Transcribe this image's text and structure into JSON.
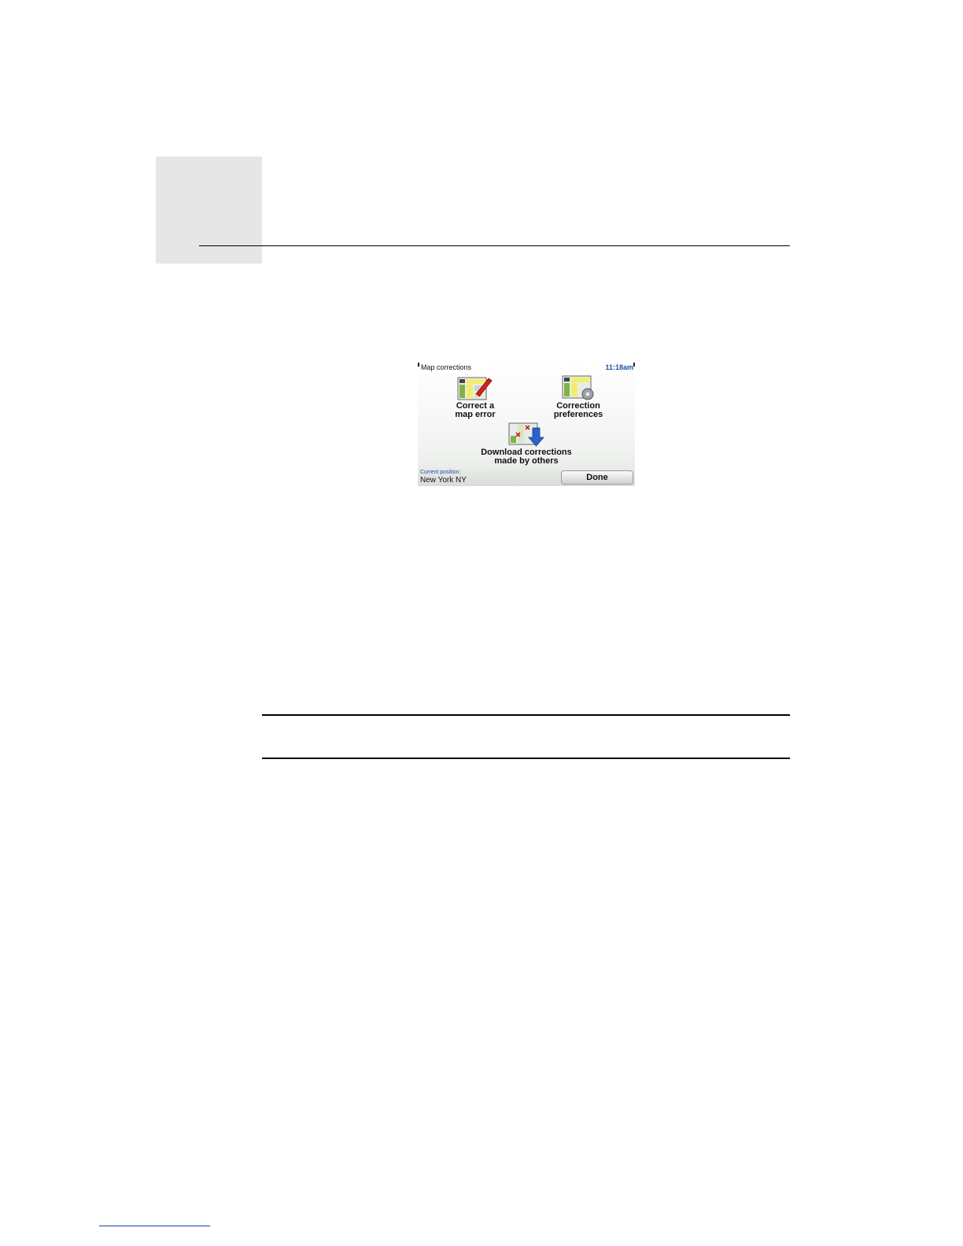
{
  "screenshot": {
    "title": "Map corrections",
    "clock": "11:18am",
    "buttons": [
      {
        "line1": "Correct a",
        "line2": "map error",
        "icon": "map-pencil-icon"
      },
      {
        "line1": "Correction",
        "line2": "preferences",
        "icon": "map-gear-icon"
      },
      {
        "line1": "Download corrections",
        "line2": "made by others",
        "icon": "map-download-icon"
      }
    ],
    "position_label": "Current position:",
    "position_value": "New York NY",
    "done_label": "Done"
  },
  "colors": {
    "accent_blue": "#1a4fa8",
    "chapter_box": "#e6e6e6"
  }
}
